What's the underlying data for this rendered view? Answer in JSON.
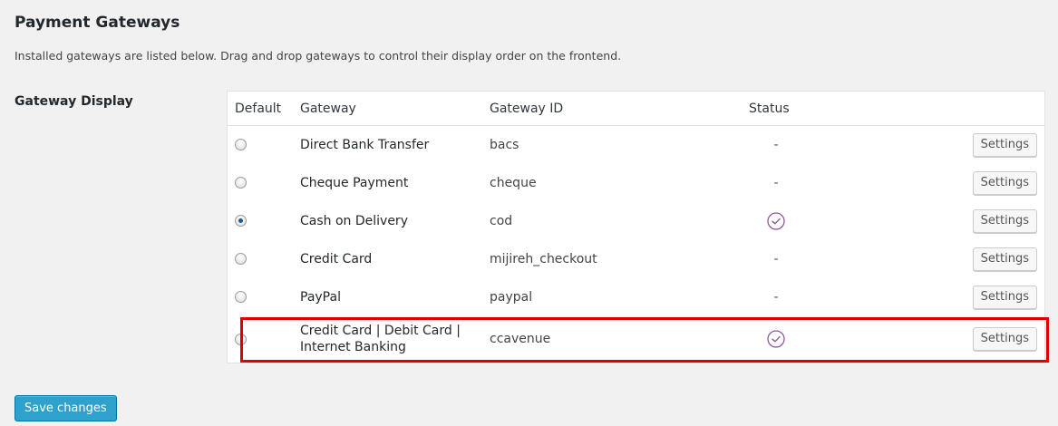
{
  "page": {
    "title": "Payment Gateways",
    "description": "Installed gateways are listed below. Drag and drop gateways to control their display order on the frontend."
  },
  "gateway_display": {
    "label": "Gateway Display",
    "columns": {
      "default": "Default",
      "gateway": "Gateway",
      "gateway_id": "Gateway ID",
      "status": "Status"
    },
    "rows": [
      {
        "name": "Direct Bank Transfer",
        "id": "bacs",
        "default": false,
        "status": "-",
        "enabled": false,
        "action": "Settings"
      },
      {
        "name": "Cheque Payment",
        "id": "cheque",
        "default": false,
        "status": "-",
        "enabled": false,
        "action": "Settings"
      },
      {
        "name": "Cash on Delivery",
        "id": "cod",
        "default": true,
        "status": "",
        "enabled": true,
        "action": "Settings"
      },
      {
        "name": "Credit Card",
        "id": "mijireh_checkout",
        "default": false,
        "status": "-",
        "enabled": false,
        "action": "Settings"
      },
      {
        "name": "PayPal",
        "id": "paypal",
        "default": false,
        "status": "-",
        "enabled": false,
        "action": "Settings"
      },
      {
        "name": "Credit Card | Debit Card | Internet Banking",
        "id": "ccavenue",
        "default": false,
        "status": "",
        "enabled": true,
        "action": "Settings",
        "highlighted": true
      }
    ],
    "enabled_icon": "check-circle-icon"
  },
  "footer": {
    "save_label": "Save changes"
  },
  "colors": {
    "enabled_check": "#8e5a9a",
    "highlight": "#e00000",
    "primary_button": "#2ea2cc"
  }
}
